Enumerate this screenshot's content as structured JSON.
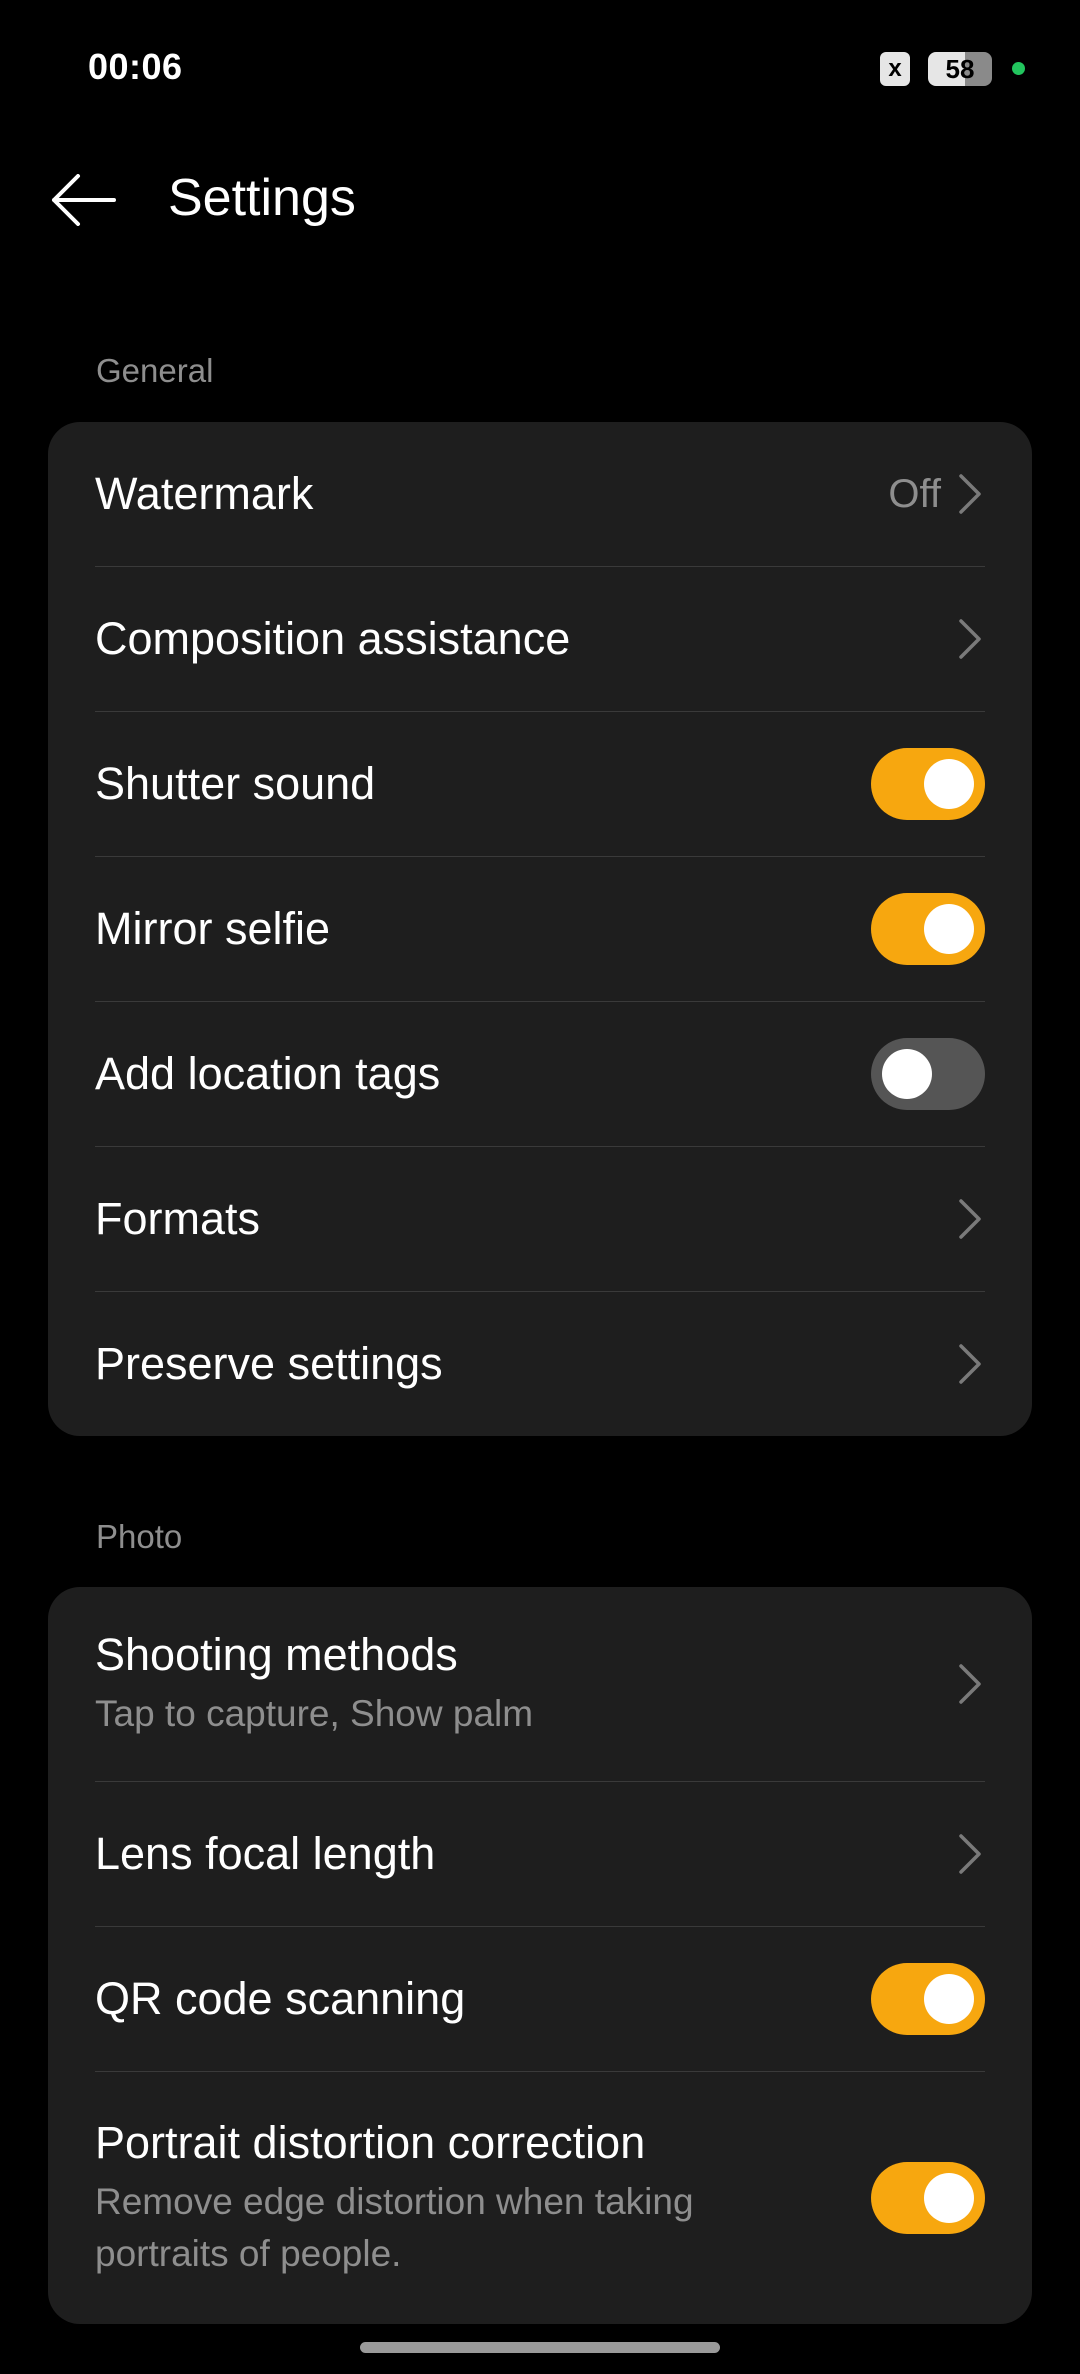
{
  "status_bar": {
    "time": "00:06",
    "notification_icon": "x",
    "battery": "58",
    "battery_icon": "battery-icon",
    "indicator_color": "#22c55e"
  },
  "header": {
    "back_icon": "arrow-left-icon",
    "title": "Settings"
  },
  "theme": {
    "accent": "#f7a70f",
    "card_bg": "#1e1e1e",
    "secondary_text": "#8e8e8e"
  },
  "sections": {
    "general": {
      "label": "General",
      "items": {
        "watermark": {
          "title": "Watermark",
          "value": "Off"
        },
        "composition": {
          "title": "Composition assistance"
        },
        "shutter_sound": {
          "title": "Shutter sound",
          "toggle": true
        },
        "mirror_selfie": {
          "title": "Mirror selfie",
          "toggle": true
        },
        "location_tags": {
          "title": "Add location tags",
          "toggle": false
        },
        "formats": {
          "title": "Formats"
        },
        "preserve": {
          "title": "Preserve settings"
        }
      }
    },
    "photo": {
      "label": "Photo",
      "items": {
        "shooting_methods": {
          "title": "Shooting methods",
          "subtitle": "Tap to capture, Show palm"
        },
        "lens_focal": {
          "title": "Lens focal length"
        },
        "qr_scanning": {
          "title": "QR code scanning",
          "toggle": true
        },
        "portrait_distortion": {
          "title": "Portrait distortion correction",
          "subtitle": "Remove edge distortion when taking portraits of people.",
          "toggle": true
        }
      }
    }
  }
}
